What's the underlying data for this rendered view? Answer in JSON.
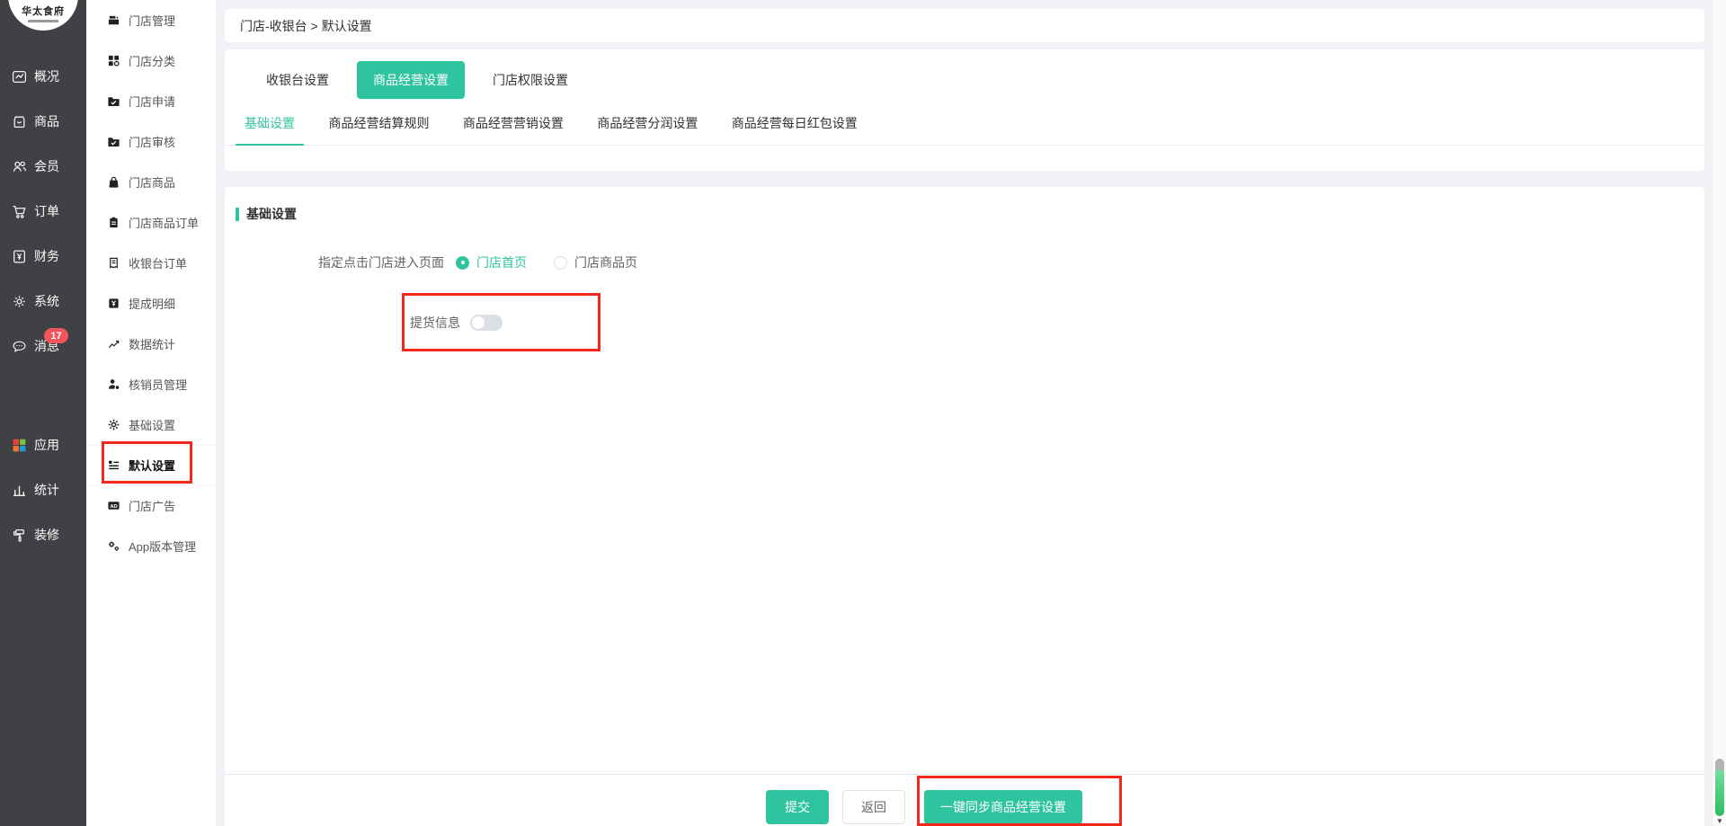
{
  "colors": {
    "accent": "#2fc4a0",
    "annotation_red": "#f3281d",
    "badge_red": "#f4555c",
    "sidebar_dark": "#404144"
  },
  "logo": {
    "title": "华太食府"
  },
  "primary_sidebar": {
    "items": [
      {
        "icon": "overview-icon",
        "label": "概况"
      },
      {
        "icon": "goods-icon",
        "label": "商品"
      },
      {
        "icon": "members-icon",
        "label": "会员"
      },
      {
        "icon": "orders-icon",
        "label": "订单"
      },
      {
        "icon": "finance-icon",
        "label": "财务"
      },
      {
        "icon": "system-icon",
        "label": "系统"
      },
      {
        "icon": "messages-icon",
        "label": "消息",
        "badge": "17"
      },
      {
        "icon": "apps-icon",
        "label": "应用"
      },
      {
        "icon": "statistics-icon",
        "label": "统计"
      },
      {
        "icon": "decorate-icon",
        "label": "装修"
      }
    ]
  },
  "secondary_sidebar": {
    "active": "默认设置",
    "items": [
      {
        "icon": "store-manage-icon",
        "label": "门店管理"
      },
      {
        "icon": "store-category-icon",
        "label": "门店分类"
      },
      {
        "icon": "store-apply-icon",
        "label": "门店申请"
      },
      {
        "icon": "store-audit-icon",
        "label": "门店审核"
      },
      {
        "icon": "store-goods-icon",
        "label": "门店商品"
      },
      {
        "icon": "store-goods-order-icon",
        "label": "门店商品订单"
      },
      {
        "icon": "cashier-order-icon",
        "label": "收银台订单"
      },
      {
        "icon": "commission-icon",
        "label": "提成明细"
      },
      {
        "icon": "data-stats-icon",
        "label": "数据统计"
      },
      {
        "icon": "verifier-manage-icon",
        "label": "核销员管理"
      },
      {
        "icon": "basic-settings-icon",
        "label": "基础设置"
      },
      {
        "icon": "default-settings-icon",
        "label": "默认设置"
      },
      {
        "icon": "store-ad-icon",
        "label": "门店广告"
      },
      {
        "icon": "app-version-icon",
        "label": "App版本管理"
      }
    ]
  },
  "breadcrumb": {
    "text": "门店-收银台 > 默认设置"
  },
  "tabs": {
    "active": "商品经营设置",
    "items": [
      {
        "label": "收银台设置"
      },
      {
        "label": "商品经营设置"
      },
      {
        "label": "门店权限设置"
      }
    ]
  },
  "subtabs": {
    "active": "基础设置",
    "items": [
      {
        "label": "基础设置"
      },
      {
        "label": "商品经营结算规则"
      },
      {
        "label": "商品经营营销设置"
      },
      {
        "label": "商品经营分润设置"
      },
      {
        "label": "商品经营每日红包设置"
      }
    ]
  },
  "section": {
    "title": "基础设置"
  },
  "form": {
    "entry_page_label": "指定点击门店进入页面",
    "entry_options": [
      {
        "label": "门店首页",
        "selected": true
      },
      {
        "label": "门店商品页",
        "selected": false
      }
    ],
    "pickup_label": "提货信息",
    "pickup_toggle": "off"
  },
  "footer": {
    "submit_label": "提交",
    "back_label": "返回",
    "sync_label": "一键同步商品经营设置"
  }
}
